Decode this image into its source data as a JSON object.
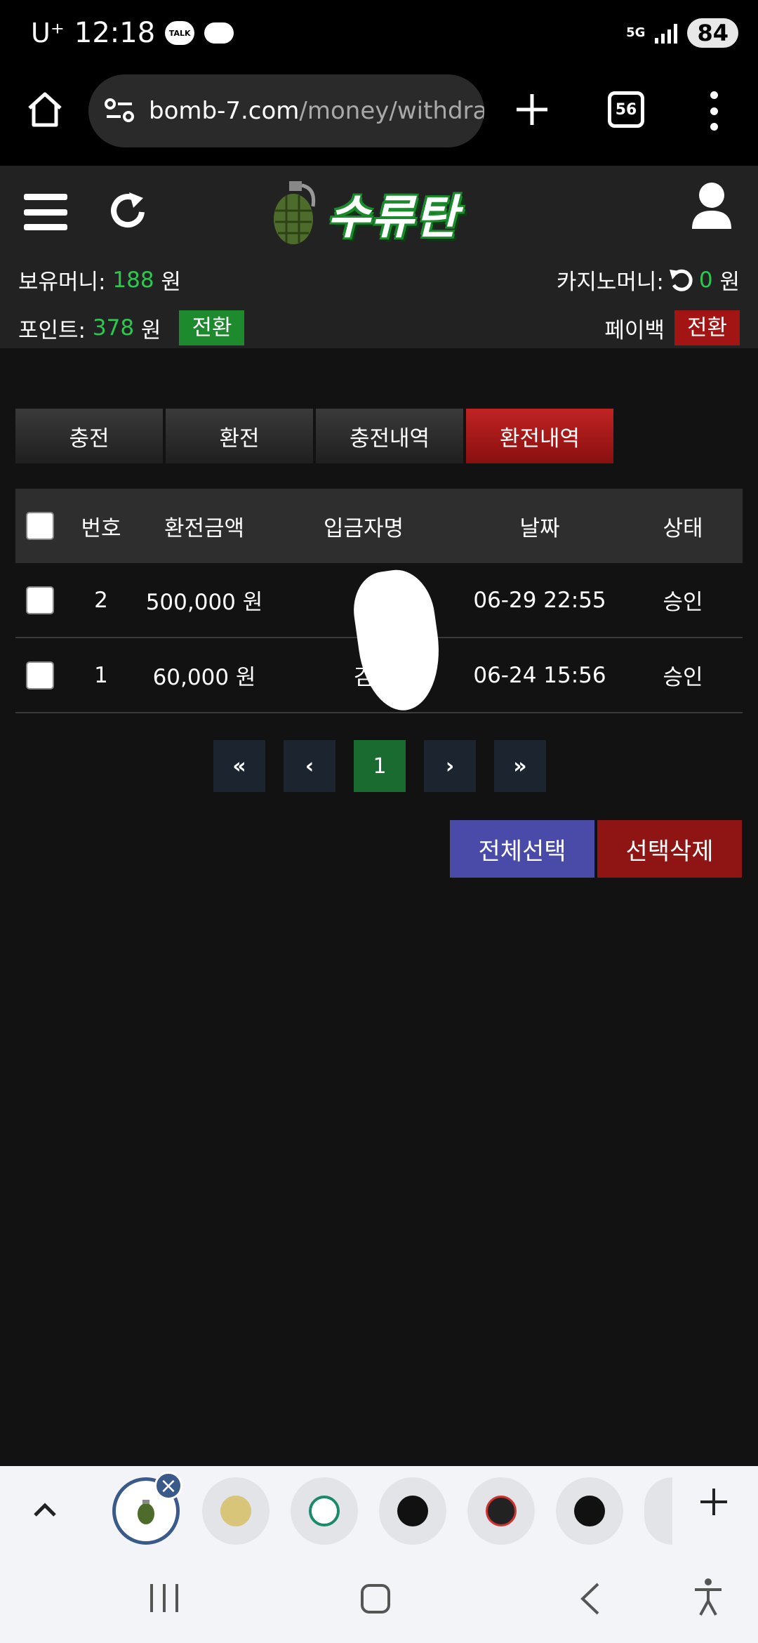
{
  "status_bar": {
    "carrier": "U⁺",
    "time": "12:18",
    "talk_badge": "TALK",
    "network": "5G",
    "battery": "84"
  },
  "browser": {
    "url_domain": "bomb-7.com",
    "url_path": "/money/withdrawa",
    "tab_count": "56"
  },
  "header": {
    "logo_text": "수류탄"
  },
  "balances": {
    "holding_label": "보유머니:",
    "holding_value": "188",
    "holding_unit": "원",
    "casino_label": "카지노머니:",
    "casino_value": "0",
    "casino_unit": "원",
    "points_label": "포인트:",
    "points_value": "378",
    "points_unit": "원",
    "convert_label": "전환",
    "payback_label": "페이백",
    "payback_convert_label": "전환"
  },
  "tabs": [
    {
      "label": "충전",
      "active": false
    },
    {
      "label": "환전",
      "active": false
    },
    {
      "label": "충전내역",
      "active": false
    },
    {
      "label": "환전내역",
      "active": true
    }
  ],
  "table": {
    "headers": {
      "no": "번호",
      "amount": "환전금액",
      "depositor": "입금자명",
      "date": "날짜",
      "status": "상태"
    },
    "rows": [
      {
        "no": "2",
        "amount": "500,000 원",
        "depositor": "",
        "date": "06-29 22:55",
        "status": "승인"
      },
      {
        "no": "1",
        "amount": "60,000 원",
        "depositor": "김",
        "date": "06-24 15:56",
        "status": "승인"
      }
    ]
  },
  "pagination": {
    "first": "«",
    "prev": "‹",
    "current": "1",
    "next": "›",
    "last": "»"
  },
  "actions": {
    "select_all": "전체선택",
    "delete_selected": "선택삭제"
  },
  "colors": {
    "accent_green": "#2dc653",
    "active_tab_red": "#c02323",
    "select_all_blue": "#4a4aa8"
  }
}
